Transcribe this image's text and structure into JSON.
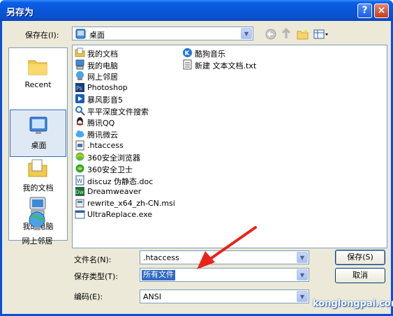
{
  "window": {
    "title": "另存为",
    "help_label": "?",
    "close_label": "×"
  },
  "save_in": {
    "label": "保存在(I):",
    "value": "桌面"
  },
  "places": [
    {
      "label": "Recent",
      "icon": "recent-icon"
    },
    {
      "label": "桌面",
      "icon": "desktop-icon"
    },
    {
      "label": "我的文档",
      "icon": "my-documents-icon"
    },
    {
      "label": "我的电脑",
      "icon": "my-computer-icon"
    },
    {
      "label": "网上邻居",
      "icon": "network-icon"
    }
  ],
  "files_col1": [
    {
      "name": "我的文档",
      "icon": "folder-icon"
    },
    {
      "name": "我的电脑",
      "icon": "computer-icon"
    },
    {
      "name": "网上邻居",
      "icon": "network-icon"
    },
    {
      "name": "Photoshop",
      "icon": "photoshop-icon"
    },
    {
      "name": "暴风影音5",
      "icon": "player-icon"
    },
    {
      "name": "平平深度文件搜索",
      "icon": "search-tool-icon"
    },
    {
      "name": "腾讯QQ",
      "icon": "qq-icon"
    },
    {
      "name": "腾讯微云",
      "icon": "cloud-icon"
    },
    {
      "name": ".htaccess",
      "icon": "file-icon"
    },
    {
      "name": "360安全浏览器",
      "icon": "browser-icon"
    },
    {
      "name": "360安全卫士",
      "icon": "security-icon"
    },
    {
      "name": "discuz 伪静态.doc",
      "icon": "word-doc-icon"
    },
    {
      "name": "Dreamweaver",
      "icon": "dreamweaver-icon"
    },
    {
      "name": "rewrite_x64_zh-CN.msi",
      "icon": "installer-icon"
    },
    {
      "name": "UltraReplace.exe",
      "icon": "exe-icon"
    }
  ],
  "files_col2": [
    {
      "name": "酷狗音乐",
      "icon": "music-icon"
    },
    {
      "name": "新建 文本文档.txt",
      "icon": "text-file-icon"
    }
  ],
  "filename": {
    "label": "文件名(N):",
    "value": ".htaccess"
  },
  "filetype": {
    "label": "保存类型(T):",
    "value": "所有文件"
  },
  "encoding": {
    "label": "编码(E):",
    "value": "ANSI"
  },
  "buttons": {
    "save": "保存(S)",
    "cancel": "取消"
  },
  "watermark": "konglongpai.com",
  "colors": {
    "title_bar": "#0a5fe8",
    "dialog_bg": "#ece9d8",
    "border": "#7f9db9",
    "arrow": "#e8241a",
    "selection": "#316ac5"
  }
}
